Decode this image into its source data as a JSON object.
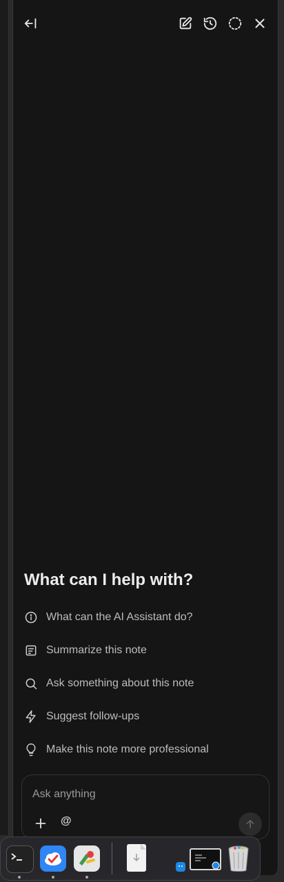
{
  "header": {
    "collapse_icon": "collapse-left-icon",
    "icons": [
      "new-chat-icon",
      "history-icon",
      "loading-icon",
      "close-icon"
    ]
  },
  "main": {
    "heading": "What can I help with?",
    "suggestions": [
      {
        "icon": "info-icon",
        "label": "What can the AI Assistant do?"
      },
      {
        "icon": "note-summary-icon",
        "label": "Summarize this note"
      },
      {
        "icon": "search-icon",
        "label": "Ask something about this note"
      },
      {
        "icon": "lightning-icon",
        "label": "Suggest follow-ups"
      },
      {
        "icon": "lightbulb-icon",
        "label": "Make this note more professional"
      }
    ]
  },
  "composer": {
    "placeholder": "Ask anything",
    "value": "",
    "mention_label": "@"
  },
  "dock": {
    "apps": [
      "terminal-app",
      "cloud-app",
      "preview-app",
      "document-app",
      "finder-app",
      "screen-app",
      "trash-app"
    ]
  },
  "colors": {
    "panel_bg": "#151515",
    "text_primary": "#ececec",
    "text_secondary": "#bdbdbd"
  }
}
